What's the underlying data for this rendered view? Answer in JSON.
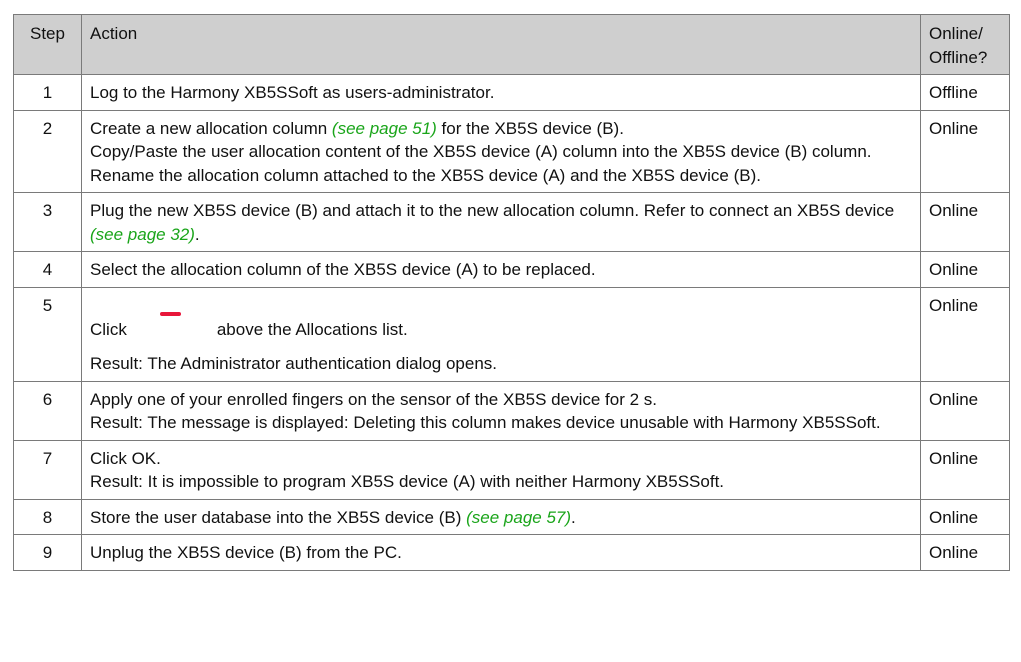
{
  "table": {
    "headers": {
      "step": "Step",
      "action": "Action",
      "mode": "Online/\nOffline?"
    },
    "rows": [
      {
        "step": "1",
        "mode": "Offline",
        "parts": [
          {
            "t": "Log to the Harmony XB5SSoft as users-administrator."
          }
        ]
      },
      {
        "step": "2",
        "mode": "Online",
        "parts": [
          {
            "t": "Create a new allocation column "
          },
          {
            "t": "(see page 51)",
            "link": true
          },
          {
            "t": " for the XB5S device "
          },
          {
            "t": "(B)",
            "b": true
          },
          {
            "t": "."
          },
          {
            "br": true
          },
          {
            "t": "Copy/Paste the user allocation content of the XB5S device "
          },
          {
            "t": "(A)",
            "b": true
          },
          {
            "t": " column into the XB5S device "
          },
          {
            "t": "(B)",
            "b": true
          },
          {
            "t": " column."
          },
          {
            "br": true
          },
          {
            "t": "Rename the allocation column attached to the XB5S device "
          },
          {
            "t": "(A)",
            "b": true
          },
          {
            "t": " and the XB5S device "
          },
          {
            "t": "(B)",
            "b": true
          },
          {
            "t": "."
          }
        ]
      },
      {
        "step": "3",
        "mode": "Online",
        "parts": [
          {
            "t": "Plug the new XB5S device "
          },
          {
            "t": "(B)",
            "b": true
          },
          {
            "t": " and attach it to the new allocation column. Refer to connect an XB5S device "
          },
          {
            "t": "(see page 32)",
            "link": true
          },
          {
            "t": "."
          }
        ]
      },
      {
        "step": "4",
        "mode": "Online",
        "parts": [
          {
            "t": "Select the allocation column of the XB5S device "
          },
          {
            "t": "(A)",
            "b": true
          },
          {
            "t": " to be replaced."
          }
        ]
      },
      {
        "step": "5",
        "mode": "Online",
        "special": "click-minus",
        "click_prefix": "Click",
        "click_suffix_1": "above the ",
        "click_suffix_bold": "Allocations",
        "click_suffix_2": " list.",
        "result_label": "Result:",
        "result_mid": " The ",
        "result_bold": "Administrator authentication",
        "result_end": " dialog opens."
      },
      {
        "step": "6",
        "mode": "Online",
        "parts": [
          {
            "t": "Apply one of your enrolled fingers on the sensor of the XB5S device for 2 s."
          },
          {
            "br": true
          },
          {
            "t": "Result:",
            "b": true
          },
          {
            "t": " The message is displayed: Deleting this column makes device unusable with Harmony XB5SSoft."
          }
        ]
      },
      {
        "step": "7",
        "mode": "Online",
        "parts": [
          {
            "t": "Click "
          },
          {
            "t": "OK",
            "b": true
          },
          {
            "t": "."
          },
          {
            "br": true
          },
          {
            "t": "Result:",
            "b": true
          },
          {
            "t": " It is impossible to program XB5S device "
          },
          {
            "t": "(A)",
            "b": true
          },
          {
            "t": " with neither Harmony XB5SSoft."
          }
        ]
      },
      {
        "step": "8",
        "mode": "Online",
        "parts": [
          {
            "t": "Store the user database into the XB5S device "
          },
          {
            "t": "(B)",
            "b": true
          },
          {
            "t": " "
          },
          {
            "t": "(see page 57)",
            "link": true
          },
          {
            "t": "."
          }
        ]
      },
      {
        "step": "9",
        "mode": "Online",
        "parts": [
          {
            "t": "Unplug the XB5S device "
          },
          {
            "t": "(B)",
            "b": true
          },
          {
            "t": " from the PC."
          }
        ]
      }
    ]
  }
}
